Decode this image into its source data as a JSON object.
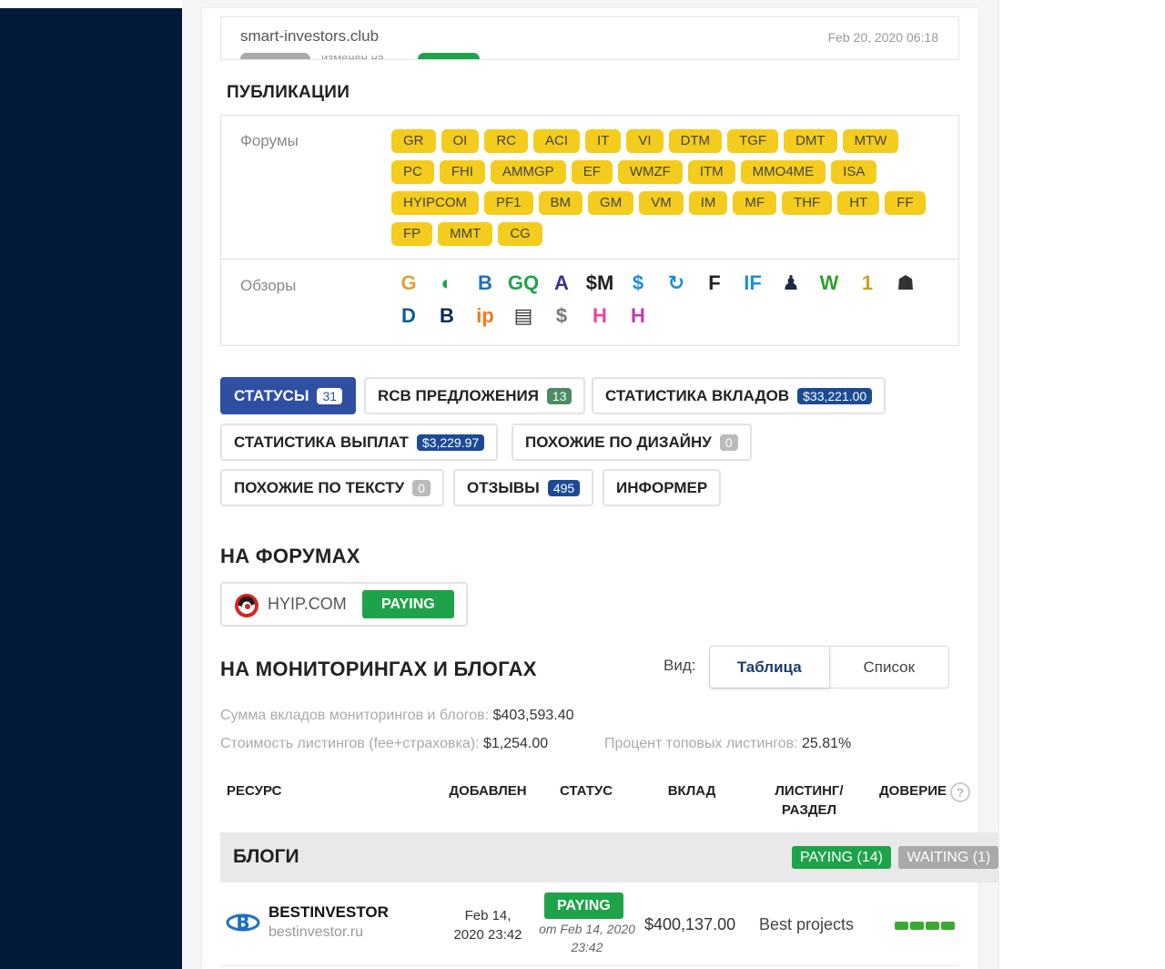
{
  "history": {
    "site": "smart-investors.club",
    "date": "Feb 20, 2020 06:18",
    "changed_text": "изменен на"
  },
  "publications": {
    "title": "ПУБЛИКАЦИИ",
    "forums_label": "Форумы",
    "reviews_label": "Обзоры",
    "forum_tags": [
      "GR",
      "OI",
      "RC",
      "ACI",
      "IT",
      "VI",
      "DTM",
      "TGF",
      "DMT",
      "MTW",
      "PC",
      "FHI",
      "AMMGP",
      "EF",
      "WMZF",
      "ITM",
      "MMO4ME",
      "ISA",
      "HYIPCOM",
      "PF1",
      "BM",
      "GM",
      "VM",
      "IM",
      "MF",
      "THF",
      "HT",
      "FF",
      "FP",
      "MMT",
      "CG"
    ],
    "review_icons": [
      {
        "name": "g-coin-icon",
        "glyph": "G",
        "color": "#e0a13a"
      },
      {
        "name": "growth-chart-icon",
        "glyph": "◐",
        "color": "#1ea34a"
      },
      {
        "name": "b-logo-icon",
        "glyph": "B",
        "color": "#1e6fbf"
      },
      {
        "name": "gq-logo-icon",
        "glyph": "GQ",
        "color": "#1ea34a"
      },
      {
        "name": "a4-logo-icon",
        "glyph": "A",
        "color": "#3c2f91"
      },
      {
        "name": "dollar-m-icon",
        "glyph": "$M",
        "color": "#222"
      },
      {
        "name": "dollar-circle-icon",
        "glyph": "$",
        "color": "#1e8fd5"
      },
      {
        "name": "refresh-logo-icon",
        "glyph": "↻",
        "color": "#1e8fd5"
      },
      {
        "name": "f-circle-icon",
        "glyph": "F",
        "color": "#222"
      },
      {
        "name": "if-logo-icon",
        "glyph": "IF",
        "color": "#1e8fd5"
      },
      {
        "name": "businessman-icon",
        "glyph": "♟",
        "color": "#1c2a48"
      },
      {
        "name": "work-money-icon",
        "glyph": "W",
        "color": "#2aa32a"
      },
      {
        "name": "number-one-badge-icon",
        "glyph": "1",
        "color": "#c9a227"
      },
      {
        "name": "wolf-head-icon",
        "glyph": "☗",
        "color": "#333"
      },
      {
        "name": "db-logo-icon",
        "glyph": "D",
        "color": "#0b5f87"
      },
      {
        "name": "b-speed-icon",
        "glyph": "B",
        "color": "#0d2a55"
      },
      {
        "name": "ip-pin-icon",
        "glyph": "ip",
        "color": "#f07a1a"
      },
      {
        "name": "document-search-icon",
        "glyph": "▤",
        "color": "#333"
      },
      {
        "name": "dollar-coin-icon",
        "glyph": "$",
        "color": "#777"
      },
      {
        "name": "h-pink-icon",
        "glyph": "H",
        "color": "#e8479a"
      },
      {
        "name": "h-pink-blue-icon",
        "glyph": "H",
        "color": "#c03bb0"
      }
    ]
  },
  "tabs": [
    {
      "label": "СТАТУСЫ",
      "count": "31"
    },
    {
      "label": "RCB ПРЕДЛОЖЕНИЯ",
      "count": "13"
    },
    {
      "label": "СТАТИСТИКА ВКЛАДОВ",
      "count": "$33,221.00"
    },
    {
      "label": "СТАТИСТИКА ВЫПЛАТ",
      "count": "$3,229.97"
    },
    {
      "label": "ПОХОЖИЕ ПО ДИЗАЙНУ",
      "count": "0"
    },
    {
      "label": "ПОХОЖИЕ ПО ТЕКСТУ",
      "count": "0"
    },
    {
      "label": "ОТЗЫВЫ",
      "count": "495"
    },
    {
      "label": "ИНФОРМЕР"
    }
  ],
  "on_forums": {
    "title": "НА ФОРУМАХ",
    "forum_name": "HYIP.COM",
    "status": "PAYING"
  },
  "monitoring": {
    "title": "НА МОНИТОРИНГАХ И БЛОГАХ",
    "view_label": "Вид:",
    "view_table": "Таблица",
    "view_list": "Список",
    "sum_label": "Сумма вкладов мониторингов и блогов:",
    "sum_value": "$403,593.40",
    "cost_label": "Стоимость листингов (fee+страховка):",
    "cost_value": "$1,254.00",
    "top_label": "Процент топовых листингов:",
    "top_value": "25.81%"
  },
  "table": {
    "headers": {
      "resource": "РЕСУРС",
      "added": "ДОБАВЛЕН",
      "status": "СТАТУС",
      "deposit": "ВКЛАД",
      "listing_1": "ЛИСТИНГ/",
      "listing_2": "РАЗДЕЛ",
      "trust": "ДОВЕРИЕ"
    },
    "group": {
      "name": "БЛОГИ",
      "paying": "PAYING (14)",
      "waiting": "WAITING (1)"
    },
    "rows": [
      {
        "name": "BESTINVESTOR",
        "url": "bestinvestor.ru",
        "added_1": "Feb 14,",
        "added_2": "2020 23:42",
        "status": "PAYING",
        "status_from_1": "от Feb 14, 2020",
        "status_from_2": "23:42",
        "deposit": "$400,137.00",
        "listing": "Best projects"
      }
    ]
  },
  "colors": {
    "sidebar": "#02193a",
    "tag_yellow": "#f4cc1e",
    "active_tab": "#2f4fa3",
    "paying_green": "#1ea34a",
    "waiting_gray": "#a9a9a9"
  }
}
